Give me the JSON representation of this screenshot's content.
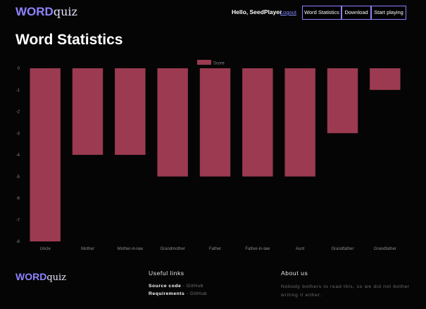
{
  "header": {
    "logo_bold": "WORD",
    "logo_rest": "quiz",
    "greeting": "Hello, SeedPlayer",
    "logout": "Logout",
    "nav": [
      "Word Statistics",
      "Download",
      "Start playing"
    ]
  },
  "page": {
    "title": "Word Statistics"
  },
  "colors": {
    "accent": "#8f83ff",
    "bar": "#9b3a50",
    "background": "#050505",
    "link": "#7f8cff"
  },
  "chart_data": {
    "type": "bar",
    "categories": [
      "Uncle",
      "Mother",
      "Mother-in-law",
      "Grandmother",
      "Father",
      "Father-in-law",
      "Aunt",
      "Grandfather",
      "Grandfather"
    ],
    "series": [
      {
        "name": "Score",
        "values": [
          -8,
          -4,
          -4,
          -5,
          -5,
          -5,
          -5,
          -3,
          -1
        ]
      }
    ],
    "ylim": [
      -8,
      0
    ],
    "yticks": [
      "0",
      "-1",
      "-2",
      "-3",
      "-4",
      "-5",
      "-6",
      "-7",
      "-8"
    ],
    "legend": "top-center",
    "grid": false,
    "xlabel": "",
    "ylabel": ""
  },
  "footer": {
    "logo_bold": "WORD",
    "logo_rest": "quiz",
    "links_heading": "Useful links",
    "links": [
      {
        "label": "Source code",
        "sep": " - ",
        "value": "GitHub"
      },
      {
        "label": "Requirements",
        "sep": " - ",
        "value": "GitHub"
      }
    ],
    "about_heading": "About us",
    "about_text": "Nobody bothers to read this, so we did not bother writing it either."
  }
}
